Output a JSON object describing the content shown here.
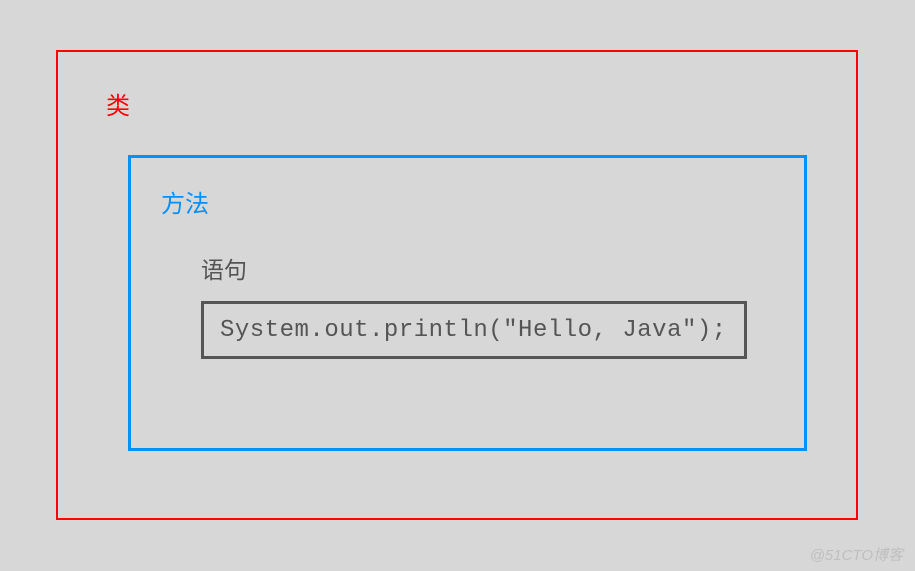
{
  "diagram": {
    "class_label": "类",
    "method_label": "方法",
    "statement_label": "语句",
    "statement_code": "System.out.println(\"Hello, Java\");"
  },
  "watermark": "@51CTO博客"
}
